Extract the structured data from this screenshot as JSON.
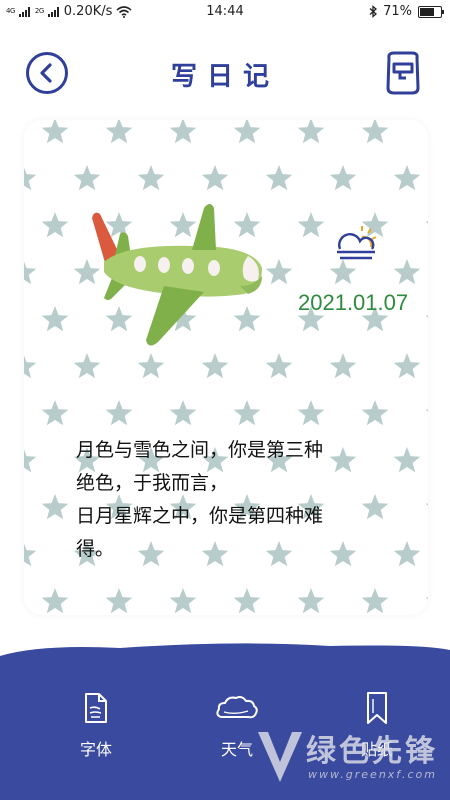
{
  "status_bar": {
    "signal_left": "4G",
    "signal_right": "2G",
    "speed": "0.20K/s",
    "time": "14:44",
    "battery_percent": "71%",
    "battery_level": 0.71
  },
  "header": {
    "title": "写日记"
  },
  "entry": {
    "date": "2021.01.07",
    "weather_icon": "sun-behind-cloud-icon",
    "lines": [
      "月色与雪色之间，你是第三种",
      "绝色，于我而言，",
      "日月星辉之中，你是第四种难",
      "得。"
    ]
  },
  "bottom_tabs": [
    {
      "label": "字体",
      "icon": "font-file-icon"
    },
    {
      "label": "天气",
      "icon": "cloud-icon"
    },
    {
      "label": "贴纸",
      "icon": "bookmark-icon"
    }
  ],
  "watermark": {
    "name": "绿色先锋",
    "url": "www.greenxf.com"
  },
  "colors": {
    "accent": "#2f3f9a",
    "bottom_bar": "#3a4a9f",
    "date": "#2e8b3e",
    "star": "#b7cccb"
  }
}
